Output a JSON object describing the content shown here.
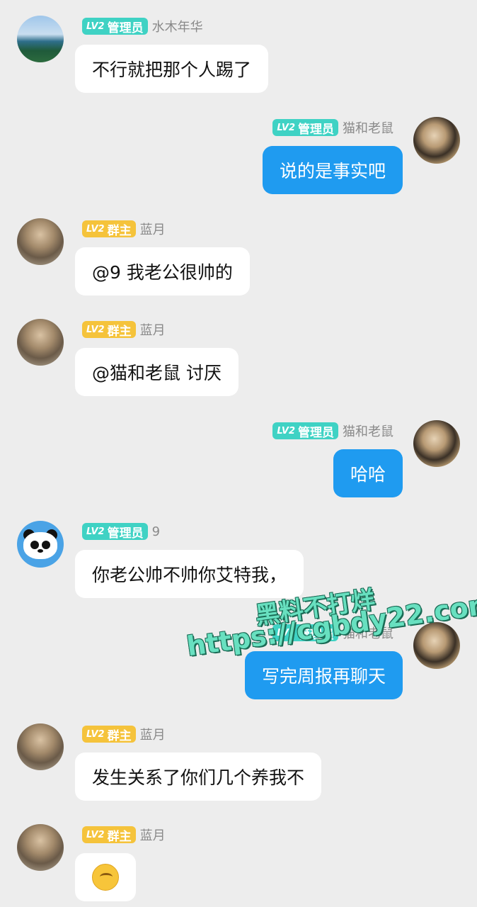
{
  "colors": {
    "background": "#ededed",
    "admin_badge": "#3fd2c4",
    "owner_badge": "#f5c33b",
    "outgoing_bubble": "#1f9bf0",
    "incoming_bubble": "#ffffff"
  },
  "messages": [
    {
      "side": "left",
      "avatar": "landscape-avatar",
      "level": "LV2",
      "role": "管理员",
      "role_type": "admin",
      "sender": "水木年华",
      "text": "不行就把那个人踢了"
    },
    {
      "side": "right",
      "avatar": "person-avatar",
      "level": "LV2",
      "role": "管理员",
      "role_type": "admin",
      "sender": "猫和老鼠",
      "text": "说的是事实吧"
    },
    {
      "side": "left",
      "avatar": "person-avatar",
      "level": "LV2",
      "role": "群主",
      "role_type": "owner",
      "sender": "蓝月",
      "text": "@9 我老公很帅的"
    },
    {
      "side": "left",
      "avatar": "person-avatar",
      "level": "LV2",
      "role": "群主",
      "role_type": "owner",
      "sender": "蓝月",
      "text": "@猫和老鼠 讨厌"
    },
    {
      "side": "right",
      "avatar": "person-avatar",
      "level": "LV2",
      "role": "管理员",
      "role_type": "admin",
      "sender": "猫和老鼠",
      "text": "哈哈"
    },
    {
      "side": "left",
      "avatar": "panda-avatar",
      "level": "LV2",
      "role": "管理员",
      "role_type": "admin",
      "sender": "9",
      "text": "你老公帅不帅你艾特我，"
    },
    {
      "side": "right",
      "avatar": "person-avatar",
      "level": "LV2",
      "role": "管理员",
      "role_type": "admin",
      "sender": "猫和老鼠",
      "text": "写完周报再聊天"
    },
    {
      "side": "left",
      "avatar": "person-avatar",
      "level": "LV2",
      "role": "群主",
      "role_type": "owner",
      "sender": "蓝月",
      "text": "发生关系了你们几个养我不"
    },
    {
      "side": "left",
      "avatar": "person-avatar",
      "level": "LV2",
      "role": "群主",
      "role_type": "owner",
      "sender": "蓝月",
      "text": "",
      "emoji": "thinking-face-emoji"
    }
  ],
  "watermark": {
    "line1": "黑料不打烊",
    "line2": "https://cgbdy22.com"
  }
}
